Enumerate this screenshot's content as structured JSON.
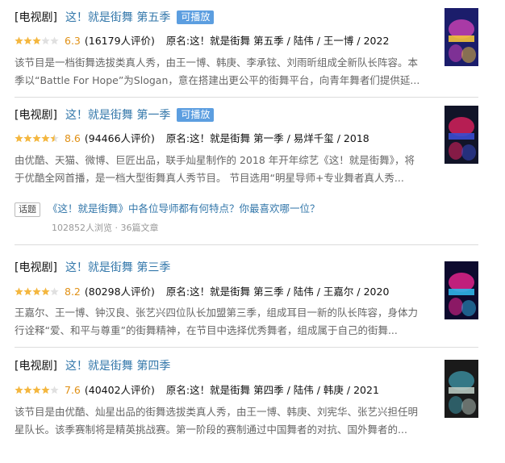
{
  "results": [
    {
      "category": "[电视剧]",
      "title": "这！就是街舞 第五季",
      "playable": "可播放",
      "rating_stars": 3,
      "score": "6.3",
      "rating_count": "(16179人评价)",
      "original_name": "原名:这！就是街舞 第五季 / 陆伟 / 王一博 / 2022",
      "description": "该节目是一档街舞选拔类真人秀，由王一博、韩庚、李承铉、刘雨昕组成全新队长阵容。本季以“Battle For Hope”为Slogan，意在搭建出更公平的街舞平台，向青年舞者们提供延...",
      "poster_colors": [
        "#1b1d6b",
        "#c23fb0",
        "#f3c33a"
      ]
    },
    {
      "category": "[电视剧]",
      "title": "这！就是街舞 第一季",
      "playable": "可播放",
      "rating_stars": 4.5,
      "score": "8.6",
      "rating_count": "(94466人评价)",
      "original_name": "原名:这！就是街舞 第一季 / 易烊千玺 / 2018",
      "description": "由优酷、天猫、微博、巨匠出品，联手灿星制作的 2018 年开年综艺《这！就是街舞》，将于优酷全网首播，是一档大型街舞真人秀节目。 节目选用“明星导师+专业舞者真人秀...",
      "poster_colors": [
        "#111428",
        "#d4205a",
        "#3a4cd0"
      ]
    },
    {
      "category": "[电视剧]",
      "title": "这！就是街舞 第三季",
      "playable": "",
      "rating_stars": 4,
      "score": "8.2",
      "rating_count": "(80298人评价)",
      "original_name": "原名:这！就是街舞 第三季 / 陆伟 / 王嘉尔 / 2020",
      "description": "王嘉尔、王一博、钟汉良、张艺兴四位队长加盟第三季，组成耳目一新的队长阵容，身体力行诠释“爱、和平与尊重”的街舞精神，在节目中选择优秀舞者，组成属于自己的街舞...",
      "poster_colors": [
        "#0d0a2e",
        "#e0238a",
        "#2fb4e8"
      ]
    },
    {
      "category": "[电视剧]",
      "title": "这！就是街舞 第四季",
      "playable": "",
      "rating_stars": 4,
      "score": "7.6",
      "rating_count": "(40402人评价)",
      "original_name": "原名:这！就是街舞 第四季 / 陆伟 / 韩庚 / 2021",
      "description": "该节目是由优酷、灿星出品的街舞选拔类真人秀，由王一博、韩庚、刘宪华、张艺兴担任明星队长。该季赛制将是精英挑战赛。第一阶段的赛制通过中国舞者的对抗、国外舞者的...",
      "poster_colors": [
        "#1a1a1a",
        "#3a8a9a",
        "#b8c8c0"
      ]
    }
  ],
  "topic": {
    "tag": "话题",
    "question": "《这！就是街舞》中各位导师都有何特点？你最喜欢哪一位？",
    "stats": "102852人浏览 · 36篇文章"
  },
  "colors": {
    "link": "#3377aa",
    "score": "#e09015",
    "star_on": "#f4b740",
    "star_off": "#e0e0e0",
    "playable_bg": "#5c9ee0"
  }
}
